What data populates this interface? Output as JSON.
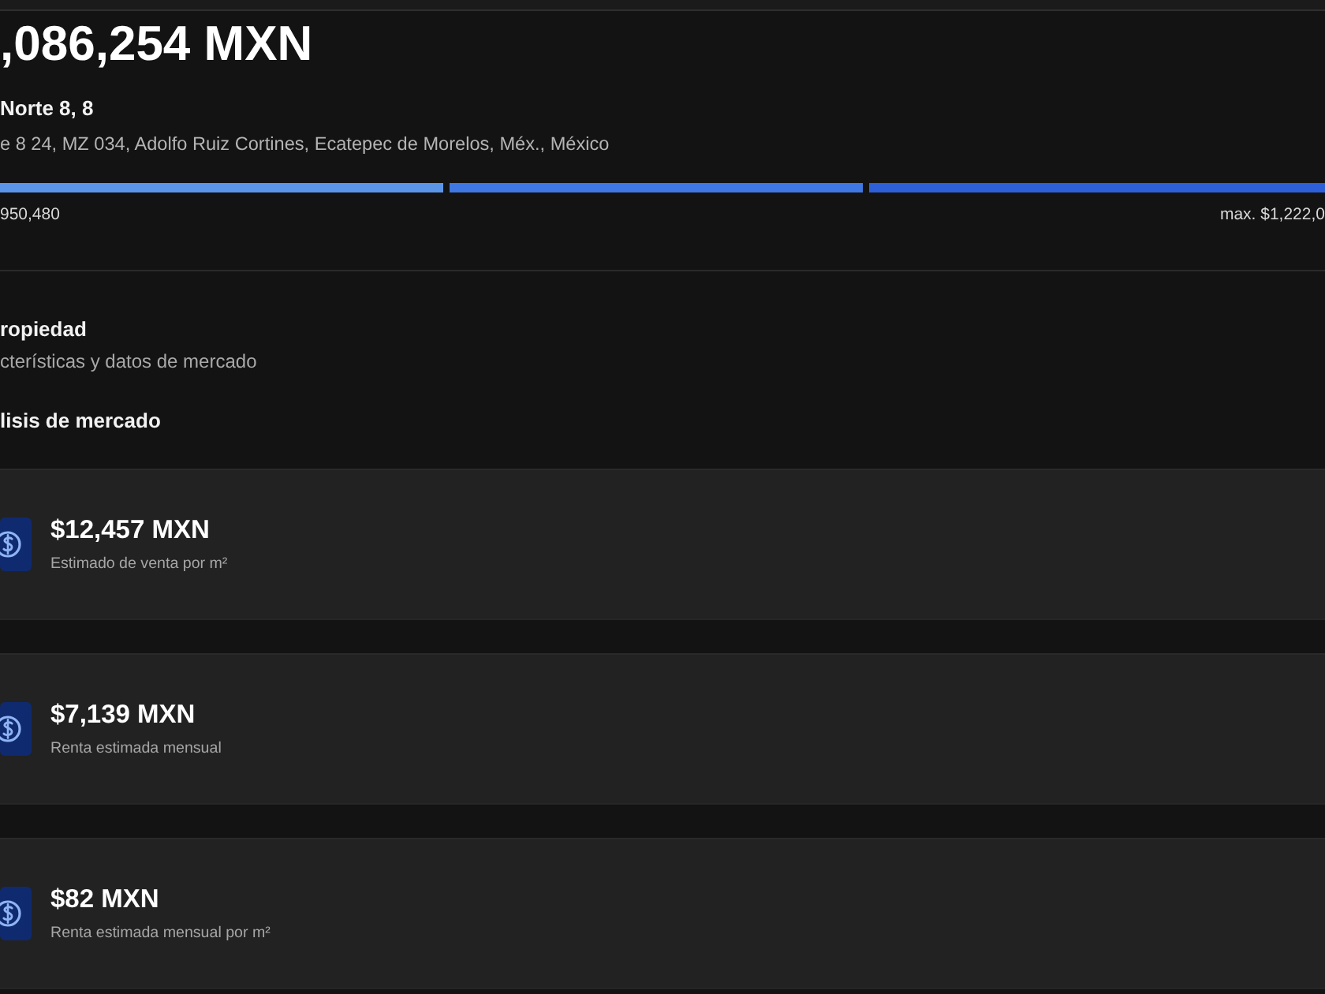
{
  "listing": {
    "price": ",086,254 MXN",
    "street": "Norte 8, 8",
    "address": "e 8 24, MZ 034, Adolfo Ruiz Cortines, Ecatepec de Morelos, Méx., México"
  },
  "price_range": {
    "segments": [
      {
        "color": "#5b95e8"
      },
      {
        "color": "#3f78e2"
      },
      {
        "color": "#2c5fd8"
      }
    ],
    "min_label": "950,480",
    "max_label": "max. $1,222,0"
  },
  "property_section": {
    "title": "ropiedad",
    "subtitle": "cterísticas y datos de mercado"
  },
  "market_analysis": {
    "title": "lisis de mercado",
    "cards": [
      {
        "value": "$12,457 MXN",
        "label": "Estimado de venta por m²"
      },
      {
        "value": "$7,139 MXN",
        "label": "Renta estimada mensual"
      },
      {
        "value": "$82 MXN",
        "label": "Renta estimada mensual por m²"
      }
    ]
  }
}
